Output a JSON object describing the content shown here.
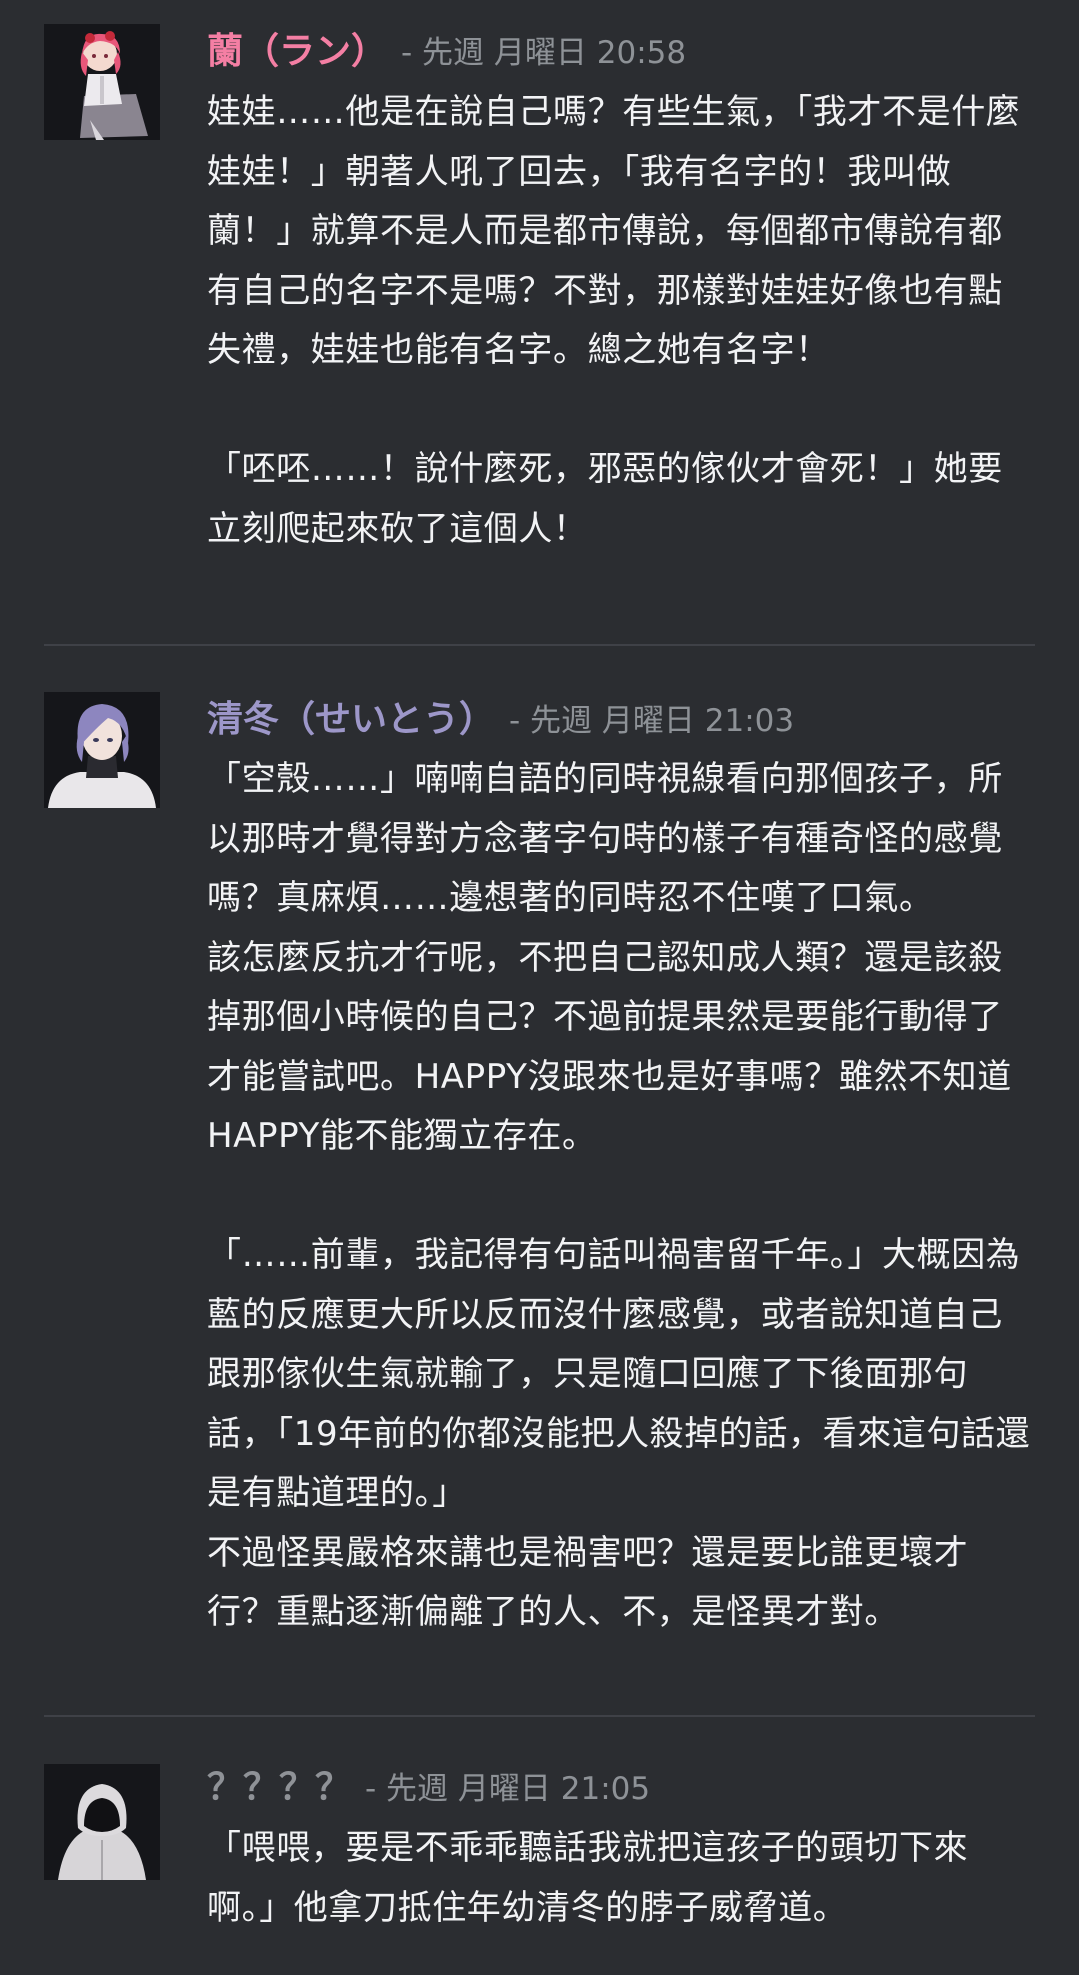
{
  "messages": [
    {
      "author": "蘭（ラン）",
      "author_color": "#f47fa4",
      "meta": "- 先週 月曜日 20:58",
      "text": "娃娃……他是在說自己嗎？有些生氣，「我才不是什麼娃娃！」朝著人吼了回去，「我有名字的！我叫做蘭！」就算不是人而是都市傳說，每個都市傳說有都有自己的名字不是嗎？不對，那樣對娃娃好像也有點失禮，娃娃也能有名字。總之她有名字！\n\n「呸呸……！說什麼死，邪惡的傢伙才會死！」她要立刻爬起來砍了這個人！"
    },
    {
      "author": "清冬（せいとう）",
      "author_color": "#9d97c9",
      "meta": "- 先週 月曜日 21:03",
      "text": "「空殼……」喃喃自語的同時視線看向那個孩子，所以那時才覺得對方念著字句時的樣子有種奇怪的感覺嗎？真麻煩……邊想著的同時忍不住嘆了口氣。\n該怎麼反抗才行呢，不把自己認知成人類？還是該殺掉那個小時候的自己？不過前提果然是要能行動得了才能嘗試吧。HAPPY沒跟來也是好事嗎？雖然不知道HAPPY能不能獨立存在。\n\n「……前輩，我記得有句話叫禍害留千年。」大概因為藍的反應更大所以反而沒什麼感覺，或者說知道自己跟那傢伙生氣就輸了，只是隨口回應了下後面那句話，「19年前的你都沒能把人殺掉的話，看來這句話還是有點道理的。」\n不過怪異嚴格來講也是禍害吧？還是要比誰更壞才行？重點逐漸偏離了的人、不，是怪異才對。"
    },
    {
      "author": "？？？？",
      "author_color": "#8f9297",
      "meta": "- 先週 月曜日 21:05",
      "text": "「喂喂，要是不乖乖聽話我就把這孩子的頭切下來啊。」他拿刀抵住年幼清冬的脖子威脅道。"
    }
  ],
  "colors": {
    "background": "#2b2d31",
    "text": "#f2f3f5",
    "timestamp": "#8e9297",
    "divider": "#3f4147"
  }
}
